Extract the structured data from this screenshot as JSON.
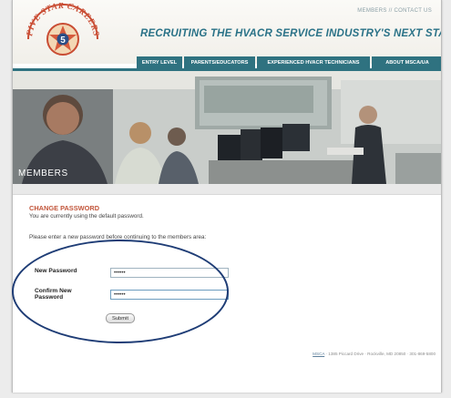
{
  "header": {
    "logo_text": "FIVE STAR CAREERS",
    "logo_number": "5",
    "top_links": {
      "members": "MEMBERS",
      "separator": "//",
      "contact": "CONTACT US"
    },
    "tagline": "RECRUITING THE HVACR SERVICE INDUSTRY'S NEXT STARS"
  },
  "nav": {
    "items": [
      {
        "label": "ENTRY LEVEL"
      },
      {
        "label": "PARENTS/EDUCATORS"
      },
      {
        "label": "EXPERIENCED HVACR TECHNICIANS"
      },
      {
        "label": "ABOUT MSCA/UA"
      }
    ]
  },
  "hero": {
    "title": "MEMBERS"
  },
  "change_password": {
    "heading": "CHANGE PASSWORD",
    "notice": "You are currently using the default password.",
    "instruction": "Please enter a new password before continuing to the members area:",
    "new_password_label": "New Password",
    "new_password_value": "••••••",
    "confirm_label_line1": "Confirm New",
    "confirm_label_line2": "Password",
    "confirm_value": "••••••",
    "submit_label": "Submit"
  },
  "footer": {
    "link": "MSCA",
    "address": " · 1385 Piccard Drive · Rockville, MD 20850 · 301-869-5800"
  },
  "colors": {
    "brand_teal": "#2f7280",
    "tagline": "#2a7287",
    "heading_orange": "#c2553a",
    "annotation_oval": "#1f3d76"
  }
}
